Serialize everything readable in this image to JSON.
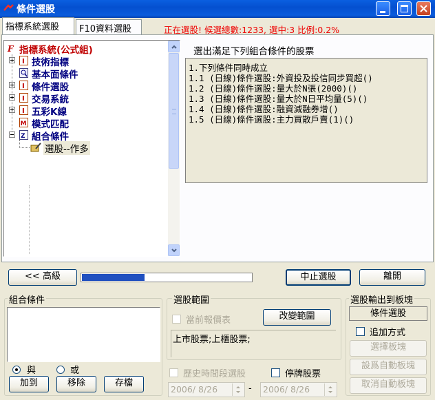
{
  "window": {
    "title": "條件選股"
  },
  "tabs": [
    {
      "label": "指標系統選股"
    },
    {
      "label": "F10資料選股"
    }
  ],
  "status": "正在選股! 候選總數:1233, 選中:3 比例:0.2%",
  "tree": {
    "root": "指標系統(公式組)",
    "items": [
      {
        "label": "技術指標"
      },
      {
        "label": "基本面條件"
      },
      {
        "label": "條件選股"
      },
      {
        "label": "交易系統"
      },
      {
        "label": "五彩K線"
      },
      {
        "label": "模式匹配"
      },
      {
        "label": "組合條件"
      }
    ],
    "child": "選股--作多"
  },
  "results": {
    "heading": "選出滿足下列組合條件的股票",
    "lines": [
      "1.下列條件同時成立",
      "  1.1 (日線)條件選股:外資投及投信同步買超()",
      "  1.2 (日線)條件選股:量大於N張(2000)()",
      "  1.3 (日線)條件選股:量大於N日平均量(5)()",
      "  1.4 (日線)條件選股:融資減融券增()",
      "  1.5 (日線)條件選股:主力買散戶賣(1)()"
    ]
  },
  "buttons": {
    "advanced": "<< 高級",
    "stop": "中止選股",
    "leave": "離開",
    "add": "加到",
    "remove": "移除",
    "save": "存檔",
    "change_range": "改變範圍",
    "select_block": "選擇板塊",
    "set_auto_block": "設爲自動板塊",
    "cancel_auto_block": "取消自動板塊"
  },
  "progress": 0.37,
  "combo": {
    "label": "組合條件",
    "and_label": "與",
    "or_label": "或",
    "selected": "and"
  },
  "range": {
    "label": "選股範圍",
    "current_quote": "當前報價表",
    "scope_text": "上市股票;上櫃股票;"
  },
  "output": {
    "label": "選股輸出到板塊",
    "target": "條件選股",
    "append": "追加方式"
  },
  "history": {
    "label": "歷史時間段選股",
    "suspended": "停牌股票",
    "start_date": "2006/ 8/26",
    "end_date": "2006/ 8/26",
    "separator": "-"
  },
  "colors": {
    "title_bar": "#0a5fe0",
    "status_red": "#e00000",
    "progress_blue": "#2050c0",
    "tree_label": "#000080",
    "root_label": "#c00000"
  }
}
